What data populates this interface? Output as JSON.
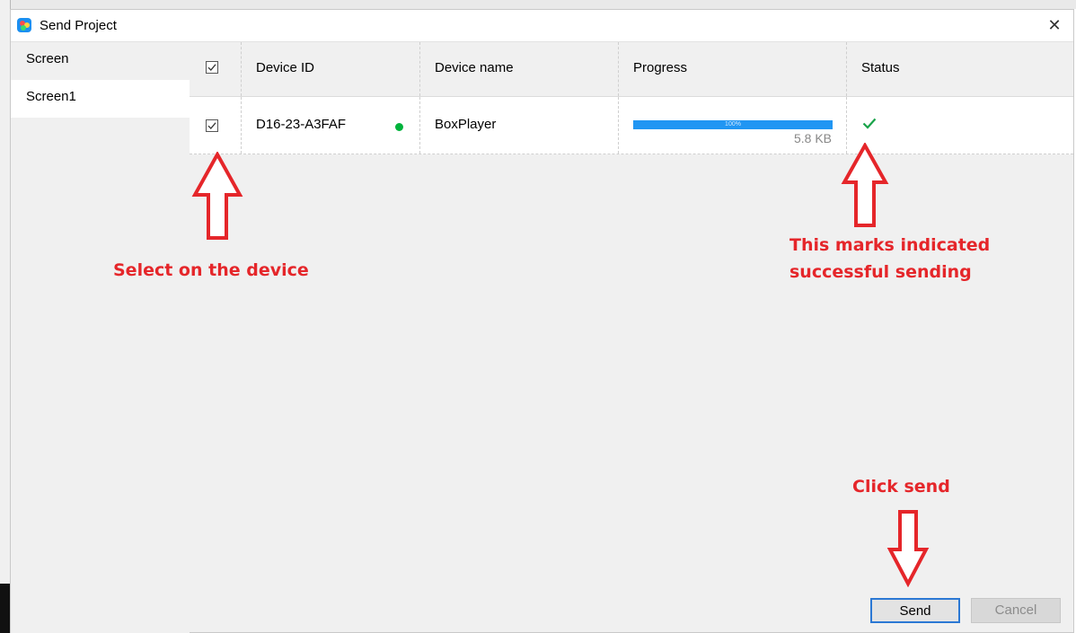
{
  "window": {
    "title": "Send Project",
    "close_glyph": "✕"
  },
  "sidebar": {
    "header": "Screen",
    "items": [
      {
        "label": "Screen1",
        "selected": true
      }
    ]
  },
  "table": {
    "columns": [
      "Device ID",
      "Device name",
      "Progress",
      "Status"
    ],
    "header_checked": true,
    "rows": [
      {
        "checked": true,
        "device_id": "D16-23-A3FAF",
        "online": true,
        "device_name": "BoxPlayer",
        "progress_percent": 100,
        "progress_label": "100%",
        "size": "5.8 KB",
        "status": "success"
      }
    ]
  },
  "annotations": {
    "select_device": "Select on the device",
    "success_line1": "This marks indicated",
    "success_line2": "successful sending",
    "click_send": "Click send"
  },
  "buttons": {
    "send": "Send",
    "cancel": "Cancel"
  },
  "colors": {
    "annotation": "#e5262a",
    "progress": "#2196f3",
    "online": "#00b33c",
    "success": "#1aa34a",
    "focus": "#2b78d4"
  }
}
